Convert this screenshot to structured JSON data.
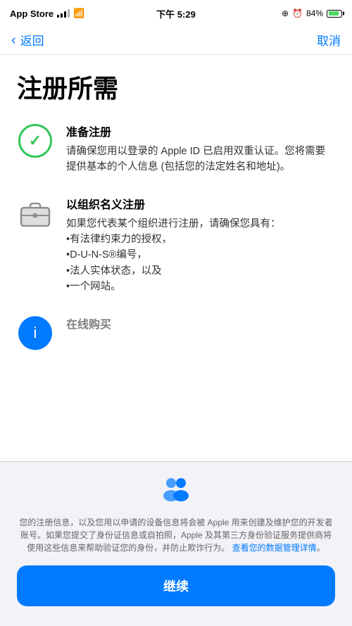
{
  "status_bar": {
    "app_name": "App Store",
    "time": "下午 5:29",
    "location_icon": "◎",
    "alarm_icon": "⏰",
    "battery_percent": "84%"
  },
  "nav": {
    "back_label": "返回",
    "cancel_label": "取消"
  },
  "page": {
    "title": "注册所需",
    "sections": [
      {
        "id": "prepare",
        "heading": "准备注册",
        "text": "请确保您用以登录的 Apple ID 已启用双重认证。您将需要提供基本的个人信息 (包括您的法定姓名和地址)。",
        "icon_type": "checkmark"
      },
      {
        "id": "organization",
        "heading": "以组织名义注册",
        "text": "如果您代表某个组织进行注册，请确保您具有：\n•有法律约束力的授权，\n•D-U-N-S®编号，\n•法人实体状态，以及\n•一个网站。",
        "icon_type": "briefcase"
      }
    ],
    "third_section_partial": true
  },
  "bottom": {
    "privacy_text_before_link": "您的注册信息，以及您用以申请的设备信息将会被 Apple 用来创建及维护您的开发者账号。如果您提交了身份证信息或自拍照，Apple 及其第三方身份验证服务提供商将使用这些信息来帮助验证您的身份，并防止欺诈行为。",
    "privacy_link_text": "查看您的数据管理详情",
    "privacy_text_after_link": "。",
    "continue_label": "继续"
  }
}
